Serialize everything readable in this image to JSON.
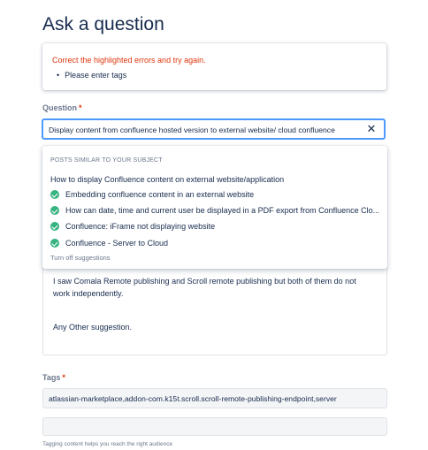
{
  "page": {
    "title": "Ask a question"
  },
  "error": {
    "title": "Correct the highlighted errors and try again.",
    "items": [
      "Please enter tags"
    ]
  },
  "question": {
    "label": "Question",
    "required_mark": "*",
    "value": "Display content from confluence hosted version to external website/ cloud confluence",
    "clear_icon": "close-icon"
  },
  "suggestions": {
    "header": "POSTS SIMILAR TO YOUR SUBJECT",
    "first": "How to display Confluence content on external website/application",
    "items": [
      "Embedding confluence content in an external website",
      "How can date, time and current user be displayed in a PDF export from Confluence Clo...",
      "Confluence: iFrame not displaying website",
      "Confluence - Server to Cloud"
    ],
    "item_icon": "check-circle-icon",
    "turn_off": "Turn off suggestions"
  },
  "body": {
    "lines": [
      "I saw Comala Remote publishing and Scroll remote publishing but both of them do not",
      "work independently.",
      "Any Other suggestion."
    ]
  },
  "tags": {
    "label": "Tags",
    "required_mark": "*",
    "value": "atlassian-marketplace,addon-com.k15t.scroll.scroll-remote-publishing-endpoint,server",
    "helper": "Tagging content helps you reach the right audience"
  },
  "colors": {
    "error": "#de350b",
    "focus": "#4c9aff",
    "success": "#36b37e",
    "text": "#172b4d",
    "subtle": "#6b778c"
  }
}
